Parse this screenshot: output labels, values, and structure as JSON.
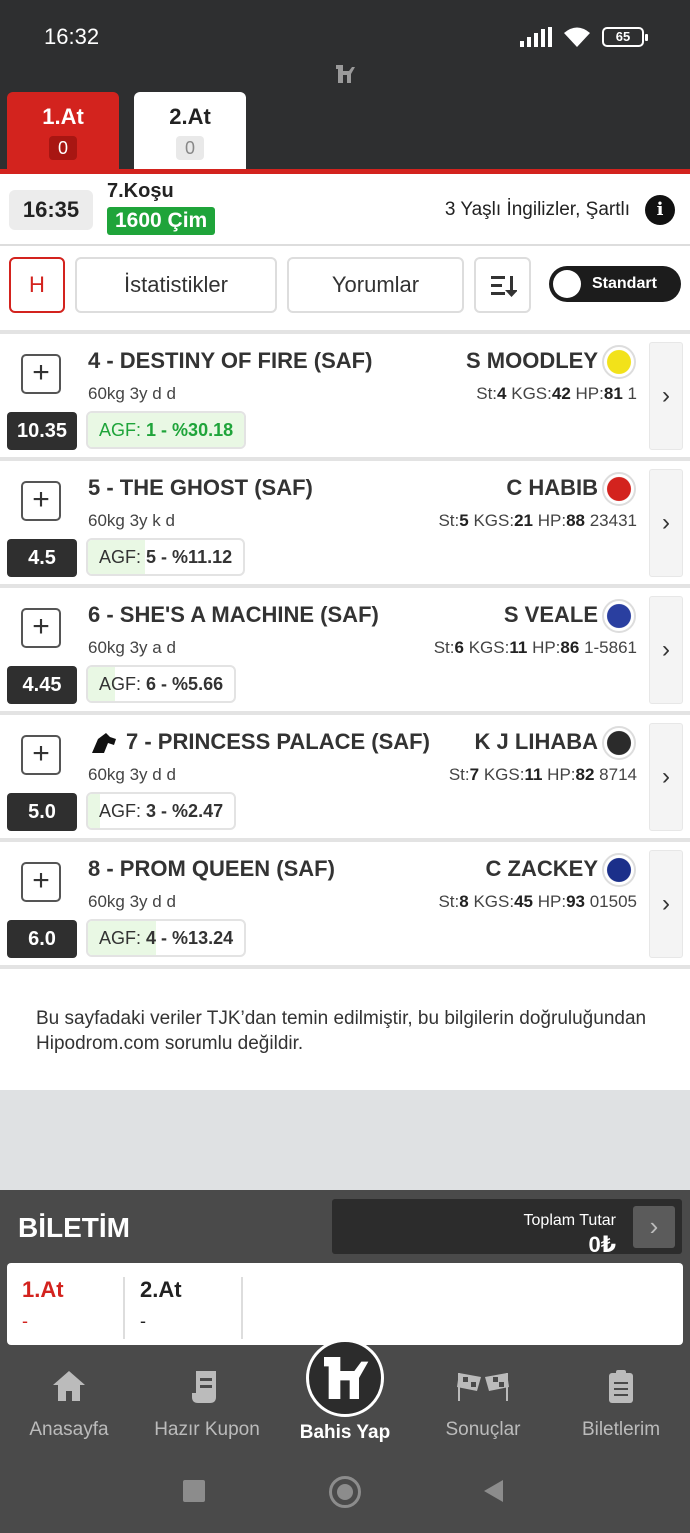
{
  "status_bar": {
    "time": "16:32",
    "battery": "65"
  },
  "tabs": [
    {
      "label": "1.At",
      "count": "0"
    },
    {
      "label": "2.At",
      "count": "0"
    }
  ],
  "race": {
    "time": "16:35",
    "number": "7.Koşu",
    "distance": "1600 Çim",
    "conditions": "3 Yaşlı İngilizler, Şartlı"
  },
  "toolbar": {
    "h_label": "H",
    "stats_label": "İstatistikler",
    "comments_label": "Yorumlar",
    "toggle_label": "Standart"
  },
  "horses": [
    {
      "name": "4 - DESTINY OF FIRE (SAF)",
      "info": "60kg 3y d d",
      "odds": "10.35",
      "agf_rank": "1",
      "agf_pct": "%30.18",
      "agf_value": 30.18,
      "jockey": "S MOODLEY",
      "st": "4",
      "kgs": "42",
      "hp": "81",
      "form": "1",
      "silk_color": "#f2e21a"
    },
    {
      "name": "5 - THE GHOST (SAF)",
      "info": "60kg 3y k d",
      "odds": "4.5",
      "agf_rank": "5",
      "agf_pct": "%11.12",
      "agf_value": 11.12,
      "jockey": "C HABIB",
      "st": "5",
      "kgs": "21",
      "hp": "88",
      "form": "23431",
      "silk_color": "#d3231e"
    },
    {
      "name": "6 - SHE'S A MACHINE (SAF)",
      "info": "60kg 3y a d",
      "odds": "4.45",
      "agf_rank": "6",
      "agf_pct": "%5.66",
      "agf_value": 5.66,
      "jockey": "S VEALE",
      "st": "6",
      "kgs": "11",
      "hp": "86",
      "form": "1-5861",
      "silk_color": "#2a3fa0"
    },
    {
      "name": "7 - PRINCESS PALACE (SAF)",
      "info": "60kg 3y d d",
      "odds": "5.0",
      "agf_rank": "3",
      "agf_pct": "%2.47",
      "agf_value": 2.47,
      "jockey": "K J LIHABA",
      "st": "7",
      "kgs": "11",
      "hp": "82",
      "form": "8714",
      "silk_color": "#2b2b2b",
      "equipment_icon": "horse-head-icon"
    },
    {
      "name": "8 - PROM QUEEN (SAF)",
      "info": "60kg 3y d d",
      "odds": "6.0",
      "agf_rank": "4",
      "agf_pct": "%13.24",
      "agf_value": 13.24,
      "jockey": "C ZACKEY",
      "st": "8",
      "kgs": "45",
      "hp": "93",
      "form": "01505",
      "silk_color": "#1b2f8a"
    }
  ],
  "labels": {
    "agf": "AGF:",
    "st": "St:",
    "kgs": "KGS:",
    "hp": "HP:"
  },
  "disclaimer": "Bu sayfadaki veriler TJK’dan temin edilmiştir, bu bilgilerin doğruluğundan Hipodrom.com sorumlu değildir.",
  "ticket": {
    "title": "BİLETİM",
    "total_label": "Toplam Tutar",
    "total_value": "0₺",
    "columns": [
      {
        "label": "1.At",
        "value": "-"
      },
      {
        "label": "2.At",
        "value": "-"
      }
    ]
  },
  "bottom_nav": [
    {
      "label": "Anasayfa",
      "icon": "home-icon"
    },
    {
      "label": "Hazır Kupon",
      "icon": "coupon-icon"
    },
    {
      "label": "Bahis Yap",
      "icon": "hipodrom-logo-icon"
    },
    {
      "label": "Sonuçlar",
      "icon": "checkered-flags-icon"
    },
    {
      "label": "Biletlerim",
      "icon": "clipboard-icon"
    }
  ]
}
